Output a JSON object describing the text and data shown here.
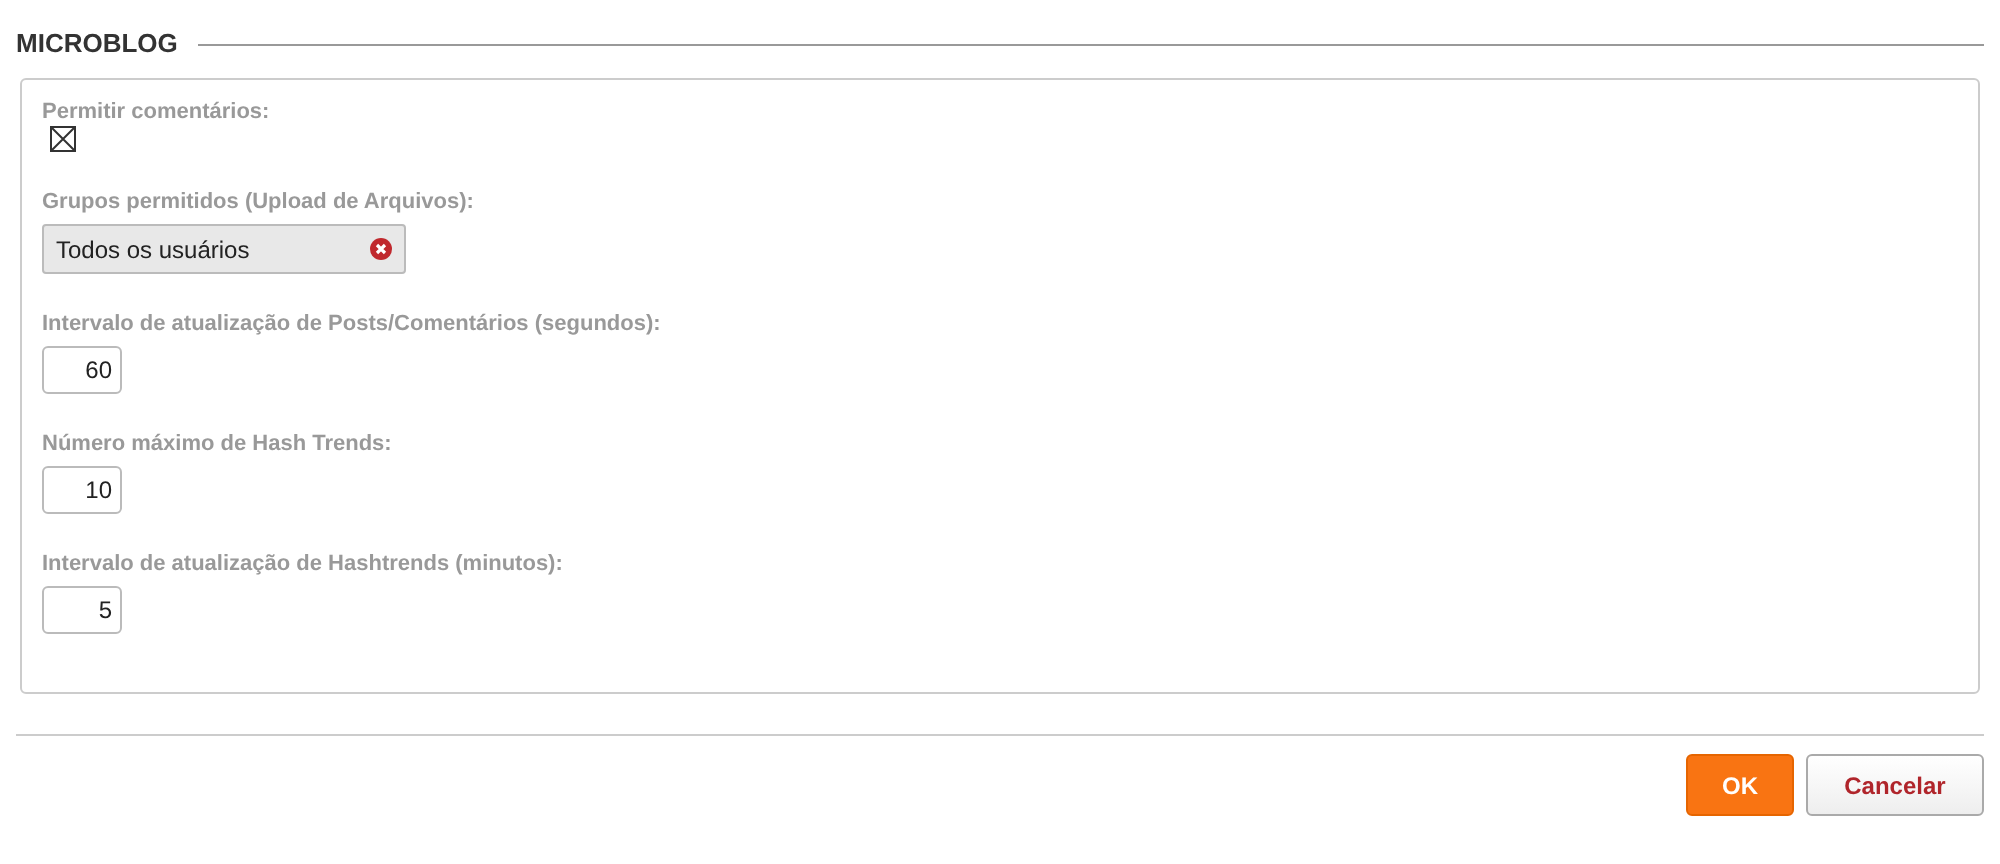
{
  "section": {
    "title": "MICROBLOG"
  },
  "fields": [
    {
      "kind": "checkbox",
      "label": "Permitir comentários:",
      "checked": true
    },
    {
      "kind": "tags",
      "label": "Grupos permitidos (Upload de Arquivos):",
      "tags": [
        "Todos os usuários"
      ]
    },
    {
      "kind": "number",
      "label": "Intervalo de atualização de Posts/Comentários (segundos):",
      "value": "60"
    },
    {
      "kind": "number",
      "label": "Número máximo de Hash Trends:",
      "value": "10"
    },
    {
      "kind": "number",
      "label": "Intervalo de atualização de Hashtrends (minutos):",
      "value": "5"
    }
  ],
  "buttons": [
    {
      "label": "OK",
      "kind": "primary"
    },
    {
      "label": "Cancelar",
      "kind": "secondary"
    }
  ]
}
